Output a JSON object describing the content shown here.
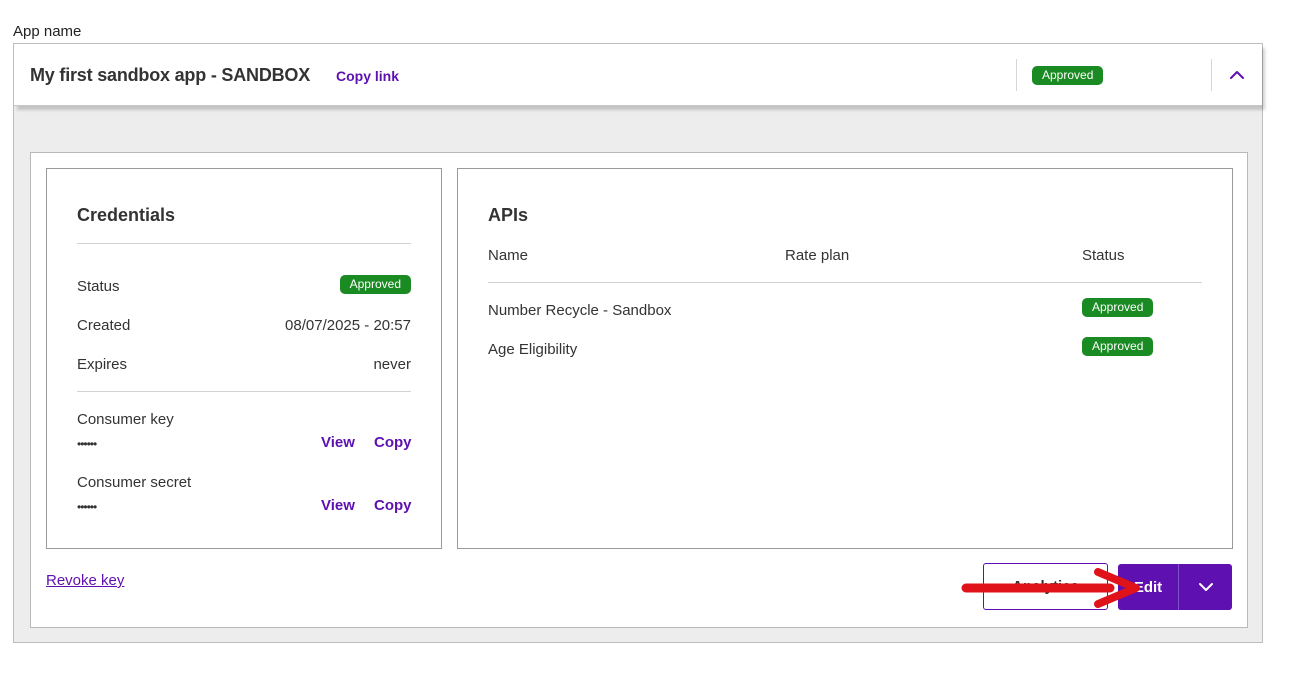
{
  "app_name_label": "App name",
  "header": {
    "title": "My first sandbox app - SANDBOX",
    "copy_link": "Copy link",
    "status": "Approved",
    "collapse_icon": "chevron-up-icon"
  },
  "credentials": {
    "title": "Credentials",
    "rows": [
      {
        "label": "Status",
        "value": "Approved"
      },
      {
        "label": "Created",
        "value": "08/07/2025 - 20:57"
      },
      {
        "label": "Expires",
        "value": "never"
      }
    ],
    "consumer_key": {
      "label": "Consumer key",
      "masked": "••••••",
      "view": "View",
      "copy": "Copy"
    },
    "consumer_secret": {
      "label": "Consumer secret",
      "masked": "••••••",
      "view": "View",
      "copy": "Copy"
    }
  },
  "apis": {
    "title": "APIs",
    "columns": [
      "Name",
      "Rate plan",
      "Status"
    ],
    "rows": [
      {
        "name": "Number Recycle - Sandbox",
        "rate_plan": "",
        "status": "Approved"
      },
      {
        "name": "Age Eligibility",
        "rate_plan": "",
        "status": "Approved"
      }
    ]
  },
  "footer": {
    "revoke_key": "Revoke key",
    "analytics": "Analytics",
    "edit": "Edit",
    "dropdown_icon": "chevron-down-icon"
  },
  "colors": {
    "accent": "#5e10b1",
    "approved": "#1a8a23",
    "annotation_arrow": "#e0131b"
  }
}
